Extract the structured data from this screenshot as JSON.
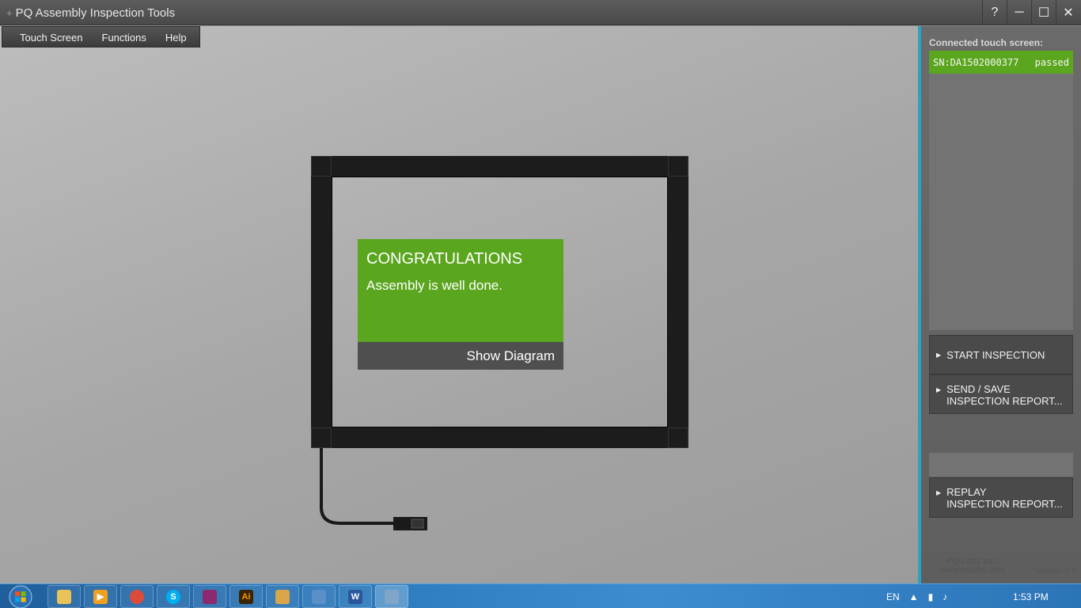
{
  "window": {
    "title": "PQ Assembly Inspection Tools",
    "title_prefix": "+",
    "help_label": "?",
    "minimize_label": "─",
    "maximize_label": "☐",
    "close_label": "✕"
  },
  "menu": {
    "items": [
      "Touch Screen",
      "Functions",
      "Help"
    ]
  },
  "card": {
    "heading": "CONGRATULATIONS",
    "message": "Assembly is well done.",
    "show_diagram_label": "Show Diagram",
    "color": "#5ba61f"
  },
  "panel": {
    "connected_label": "Connected touch screen:",
    "device_serial": "SN:DA1502000377",
    "device_status": "passed",
    "start_inspection_label": "START INSPECTION",
    "send_save_label": "SEND / SAVE\nINSPECTION REPORT...",
    "replay_label": "REPLAY\nINSPECTION REPORT...",
    "company": "PQ Labs Inc.",
    "website": "www.pqlabs.com",
    "version": "Version 2.7",
    "accent_color": "#29a3c4"
  },
  "taskbar": {
    "apps": [
      "explorer-icon",
      "media-player-icon",
      "chrome-icon",
      "skype-icon",
      "winrar-icon",
      "illustrator-icon",
      "paint-icon",
      "window-icon",
      "word-icon",
      "pq-tool-icon"
    ],
    "language": "EN",
    "time": "1:53 PM"
  }
}
